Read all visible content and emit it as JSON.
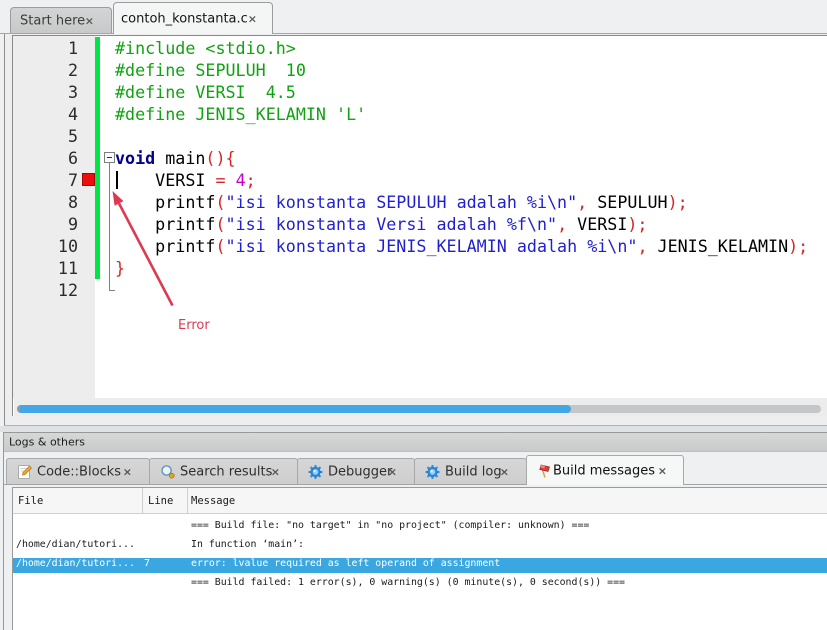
{
  "editor_tabs": [
    {
      "label": "Start here",
      "close": "×",
      "active": false
    },
    {
      "label": "contoh_konstanta.c",
      "close": "×",
      "active": true
    }
  ],
  "editor": {
    "lines": [
      {
        "num": "1",
        "segs": [
          {
            "t": "#include <stdio.h>",
            "c": "pre"
          }
        ]
      },
      {
        "num": "2",
        "segs": [
          {
            "t": "#define SEPULUH  10",
            "c": "pre"
          }
        ]
      },
      {
        "num": "3",
        "segs": [
          {
            "t": "#define VERSI  4.5",
            "c": "pre"
          }
        ]
      },
      {
        "num": "4",
        "segs": [
          {
            "t": "#define JENIS_KELAMIN 'L'",
            "c": "pre"
          }
        ]
      },
      {
        "num": "5",
        "segs": []
      },
      {
        "num": "6",
        "segs": [
          {
            "t": "void",
            "c": "kw"
          },
          {
            "t": " main",
            "c": "plain"
          },
          {
            "t": "(){",
            "c": "sym"
          }
        ]
      },
      {
        "num": "7",
        "segs": [
          {
            "t": "    VERSI ",
            "c": "plain"
          },
          {
            "t": "= ",
            "c": "sym"
          },
          {
            "t": "4",
            "c": "num"
          },
          {
            "t": ";",
            "c": "sym"
          }
        ]
      },
      {
        "num": "8",
        "segs": [
          {
            "t": "    printf",
            "c": "plain"
          },
          {
            "t": "(",
            "c": "sym"
          },
          {
            "t": "\"isi konstanta SEPULUH adalah %i\\n\"",
            "c": "str"
          },
          {
            "t": ",",
            "c": "sym"
          },
          {
            "t": " SEPULUH",
            "c": "plain"
          },
          {
            "t": ");",
            "c": "sym"
          }
        ]
      },
      {
        "num": "9",
        "segs": [
          {
            "t": "    printf",
            "c": "plain"
          },
          {
            "t": "(",
            "c": "sym"
          },
          {
            "t": "\"isi konstanta Versi adalah %f\\n\"",
            "c": "str"
          },
          {
            "t": ",",
            "c": "sym"
          },
          {
            "t": " VERSI",
            "c": "plain"
          },
          {
            "t": ");",
            "c": "sym"
          }
        ]
      },
      {
        "num": "10",
        "segs": [
          {
            "t": "    printf",
            "c": "plain"
          },
          {
            "t": "(",
            "c": "sym"
          },
          {
            "t": "\"isi konstanta JENIS_KELAMIN adalah %i\\n\"",
            "c": "str"
          },
          {
            "t": ",",
            "c": "sym"
          },
          {
            "t": " JENIS_KELAMIN",
            "c": "plain"
          },
          {
            "t": ");",
            "c": "sym"
          }
        ]
      },
      {
        "num": "11",
        "segs": [
          {
            "t": "}",
            "c": "sym"
          }
        ]
      },
      {
        "num": "12",
        "segs": []
      }
    ],
    "error_marker_line": 7,
    "fold_start_line": 6,
    "annotation_label": "Error"
  },
  "logs": {
    "caption": "Logs & others",
    "tabs": [
      {
        "label": "Code::Blocks",
        "icon": "notepad-pencil-icon",
        "close": "×",
        "active": false
      },
      {
        "label": "Search results",
        "icon": "magnifier-icon",
        "close": "×",
        "active": false
      },
      {
        "label": "Debugger",
        "icon": "gear-icon",
        "close": "×",
        "active": false
      },
      {
        "label": "Build log",
        "icon": "gear-icon",
        "close": "×",
        "active": false
      },
      {
        "label": "Build messages",
        "icon": "flag-icon",
        "close": "×",
        "active": true
      }
    ],
    "table": {
      "columns": [
        "File",
        "Line",
        "Message"
      ],
      "rows": [
        {
          "file": "",
          "line": "",
          "message": "=== Build file: \"no target\" in \"no project\" (compiler: unknown) ===",
          "selected": false
        },
        {
          "file": "/home/dian/tutori...",
          "line": "",
          "message": "In function ‘main’:",
          "selected": false
        },
        {
          "file": "/home/dian/tutori...",
          "line": "7",
          "message": "error: lvalue required as left operand of assignment",
          "selected": true
        },
        {
          "file": "",
          "line": "",
          "message": "=== Build failed: 1 error(s), 0 warning(s) (0 minute(s), 0 second(s)) ===",
          "selected": false
        }
      ]
    }
  },
  "colors": {
    "selection_blue": "#3ba7e0",
    "scrollbar_blue": "#43a7e6",
    "changebar_green": "#00e647",
    "marker_red": "#ed0f0f",
    "annotation_crimson": "#dd3a52"
  }
}
